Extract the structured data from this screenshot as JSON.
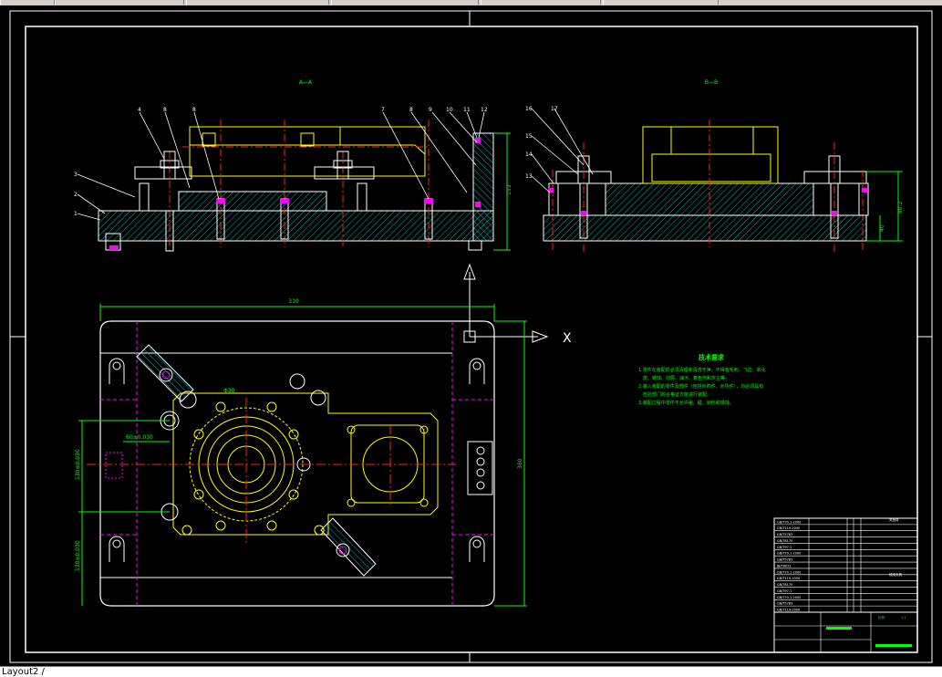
{
  "window": {
    "layout_tab": "Layout2 /"
  },
  "drawing": {
    "section_aa_title": "A—A",
    "section_bb_title": "B—B",
    "ucs_x_label": "X",
    "tech_req": {
      "title": "技术要求",
      "lines": [
        "1.零件在装配前必须清理和清洗干净，不得有毛刺、飞边、氧化",
        "皮、锈蚀、切屑、油污、着色剂和灰尘等。",
        "2.装入装配的零件及部件（包括外购件、外协件），均必须具有",
        "检验部门的合格证方能进行装配。",
        "3.装配过程中零件不允许磕、碰、划伤和锈蚀。"
      ]
    },
    "dims": {
      "plan_width": "310",
      "plan_height": "380",
      "sec_height_a": "153",
      "sec_height_b1": "80.2",
      "sec_height_b2": "40",
      "plan_left_1": "130±0.030",
      "plan_left_2": "130±0.030",
      "plan_top_1": "60±0.030",
      "dim_center": "Φ30",
      "dim_small": "Φ10"
    },
    "balloons_a": [
      "4",
      "8",
      "8",
      "7",
      "8",
      "9",
      "10",
      "11",
      "12"
    ],
    "balloons_left": [
      "3",
      "2",
      "1"
    ],
    "balloons_b": [
      "16",
      "17",
      "15",
      "14",
      "13"
    ],
    "colors": {
      "background": "#000000",
      "hatch": "#00b4b4",
      "outline": "#ffffff",
      "workpiece": "#ffff00",
      "centerline": "#ff2020",
      "hidden": "#ff00ff",
      "dimension": "#00ff00"
    }
  },
  "title_block": {
    "rows": [
      "GB/T70.1-2000",
      "GB/T119-2000",
      "GB/T5783",
      "GB/T6170",
      "GB/T97.1",
      "GB/T70.1-2000",
      "GB/T5783",
      "JB/T8021",
      "GB/T70.1-2000",
      "GB/T119-2000",
      "GB/T6170",
      "GB/T97.1",
      "GB/T70.1-2000",
      "GB/T5783",
      "GB/T119-2000"
    ],
    "right_top": "夹具体",
    "right_mid": "铣削夹具",
    "bottom_right_1": "比例",
    "bottom_right_2": "1:1"
  }
}
